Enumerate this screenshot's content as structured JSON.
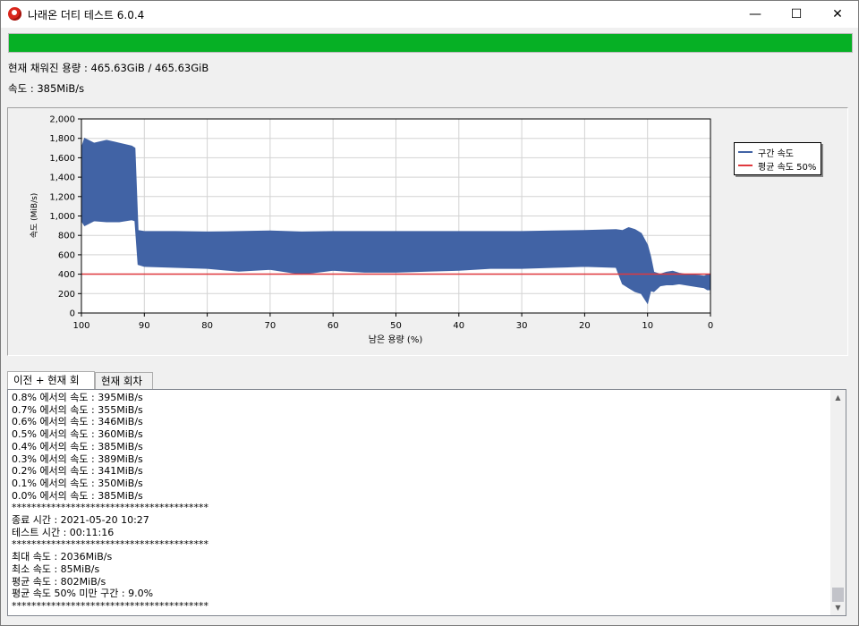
{
  "window": {
    "title": "나래온 더티 테스트 6.0.4",
    "minimize_glyph": "—",
    "maximize_glyph": "☐",
    "close_glyph": "✕"
  },
  "progress": {
    "fraction": 1.0,
    "color": "#06b025"
  },
  "status": {
    "capacity_line": "현재 채워진 용량 : 465.63GiB / 465.63GiB",
    "speed_line": "속도 : 385MiB/s"
  },
  "chart_data": {
    "type": "area",
    "ylabel": "속도 (MiB/s)",
    "xlabel": "남은 용량 (%)",
    "x_ticks": [
      "100",
      "90",
      "80",
      "70",
      "60",
      "50",
      "40",
      "30",
      "20",
      "10",
      "0"
    ],
    "y_ticks": [
      "0",
      "200",
      "400",
      "600",
      "800",
      "1,000",
      "1,200",
      "1,400",
      "1,600",
      "1,800",
      "2,000"
    ],
    "xlim": [
      100,
      0
    ],
    "ylim": [
      0,
      2000
    ],
    "grid": true,
    "legend_placement": "right",
    "series": [
      {
        "name": "구간 속도",
        "color": "#4163a5",
        "x": [
          100,
          99.5,
          98,
          96,
          94,
          92,
          91.5,
          91,
          90,
          85,
          80,
          75,
          70,
          65,
          60,
          55,
          50,
          45,
          40,
          35,
          30,
          25,
          20,
          15,
          14,
          13,
          12,
          11,
          10,
          9.5,
          9,
          8,
          7,
          6,
          5,
          4,
          3,
          2,
          1,
          0.5,
          0
        ],
        "high": [
          1700,
          1800,
          1750,
          1780,
          1750,
          1720,
          1700,
          850,
          840,
          840,
          835,
          840,
          845,
          835,
          840,
          840,
          840,
          840,
          840,
          840,
          840,
          845,
          850,
          860,
          850,
          880,
          860,
          820,
          700,
          580,
          420,
          400,
          420,
          430,
          410,
          400,
          395,
          390,
          380,
          395,
          395
        ],
        "low": [
          950,
          900,
          950,
          940,
          940,
          960,
          950,
          500,
          480,
          470,
          460,
          430,
          450,
          400,
          440,
          420,
          420,
          430,
          440,
          460,
          460,
          470,
          480,
          470,
          300,
          260,
          220,
          200,
          100,
          230,
          220,
          280,
          290,
          290,
          300,
          290,
          280,
          270,
          260,
          240,
          240
        ]
      },
      {
        "name": "평균 속도 50%",
        "color": "#e0393e",
        "value": 401
      }
    ]
  },
  "tabs": [
    {
      "label": "이전 + 현재 회차",
      "active": true
    },
    {
      "label": "현재 회차",
      "active": false
    }
  ],
  "log": {
    "lines": [
      "0.8% 에서의 속도 : 395MiB/s",
      "0.7% 에서의 속도 : 355MiB/s",
      "0.6% 에서의 속도 : 346MiB/s",
      "0.5% 에서의 속도 : 360MiB/s",
      "0.4% 에서의 속도 : 385MiB/s",
      "0.3% 에서의 속도 : 389MiB/s",
      "0.2% 에서의 속도 : 341MiB/s",
      "0.1% 에서의 속도 : 350MiB/s",
      "0.0% 에서의 속도 : 385MiB/s",
      "****************************************",
      "종료 시간 : 2021-05-20 10:27",
      "테스트 시간 : 00:11:16",
      "****************************************",
      "최대 속도 : 2036MiB/s",
      "최소 속도 : 85MiB/s",
      "평균 속도 : 802MiB/s",
      "평균 속도 50% 미만 구간 : 9.0%",
      "****************************************"
    ],
    "scroll_up_glyph": "▲",
    "scroll_down_glyph": "▼"
  }
}
